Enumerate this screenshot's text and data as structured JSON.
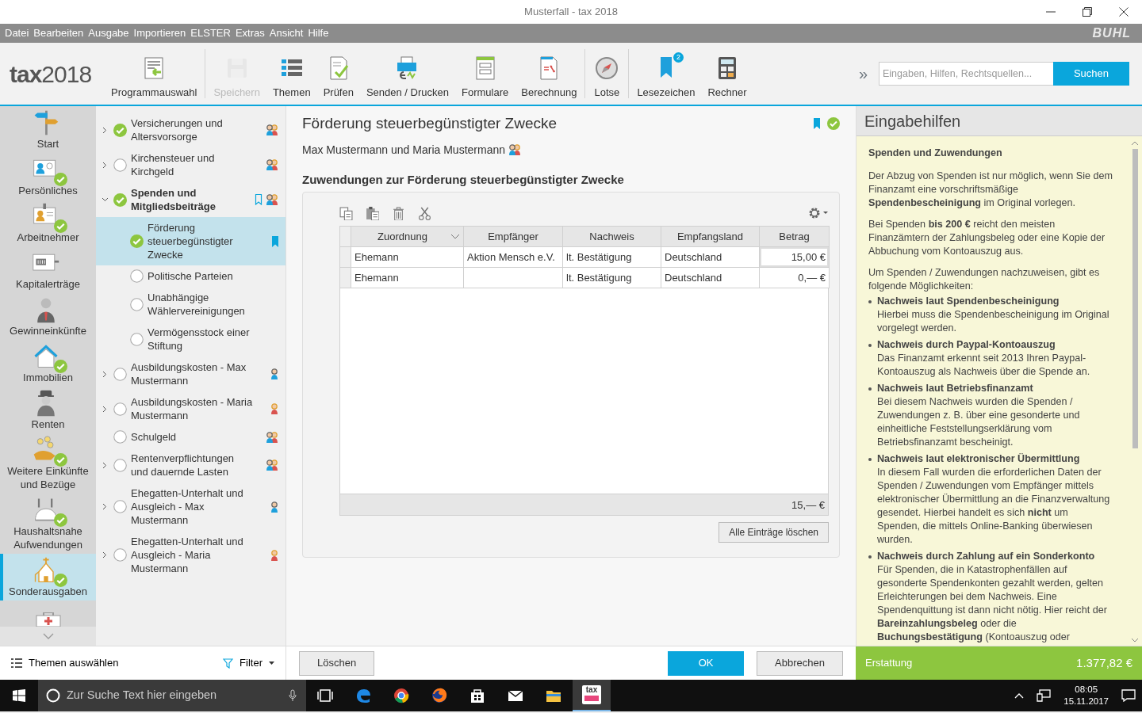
{
  "window": {
    "title": "Musterfall - tax 2018"
  },
  "menu": [
    "Datei",
    "Bearbeiten",
    "Ausgabe",
    "Importieren",
    "ELSTER",
    "Extras",
    "Ansicht",
    "Hilfe"
  ],
  "brand": "BUHL",
  "logo": "**tax**2018",
  "toolbar": [
    {
      "label": "Programmauswahl",
      "disabled": false,
      "divider_after": true
    },
    {
      "label": "Speichern",
      "disabled": true,
      "divider_after": false
    },
    {
      "label": "Themen",
      "disabled": false,
      "divider_after": false
    },
    {
      "label": "Prüfen",
      "disabled": false,
      "divider_after": false
    },
    {
      "label": "Senden / Drucken",
      "disabled": false,
      "divider_after": false
    },
    {
      "label": "Formulare",
      "disabled": false,
      "divider_after": false
    },
    {
      "label": "Berechnung",
      "disabled": false,
      "divider_after": true
    },
    {
      "label": "Lotse",
      "disabled": false,
      "divider_after": true
    },
    {
      "label": "Lesezeichen",
      "disabled": false,
      "divider_after": false,
      "badge": "2"
    },
    {
      "label": "Rechner",
      "disabled": false,
      "divider_after": false
    }
  ],
  "overflow": "»",
  "search": {
    "placeholder": "Eingaben, Hilfen, Rechtsquellen...",
    "button": "Suchen"
  },
  "nav": [
    {
      "label": "Start",
      "done": false,
      "selected": false
    },
    {
      "label": "Persönliches",
      "done": true,
      "selected": false
    },
    {
      "label": "Arbeitnehmer",
      "done": true,
      "selected": false
    },
    {
      "label": "Kapitalerträge",
      "done": false,
      "selected": false
    },
    {
      "label": "Gewinneinkünfte",
      "done": false,
      "selected": false
    },
    {
      "label": "Immobilien",
      "done": true,
      "selected": false
    },
    {
      "label": "Renten",
      "done": false,
      "selected": false
    },
    {
      "label": "Weitere Einkünfte und Bezüge",
      "done": true,
      "selected": false
    },
    {
      "label": "Haushaltsnahe Aufwendungen",
      "done": true,
      "selected": false
    },
    {
      "label": "Sonderausgaben",
      "done": true,
      "selected": true
    }
  ],
  "tree": {
    "items": [
      {
        "label": "Versicherungen und Altersvorsorge",
        "expanded": false,
        "done": true,
        "bookmarked": false,
        "selected": false,
        "husband": true,
        "wife": true
      },
      {
        "label": "Kirchensteuer und Kirchgeld",
        "expanded": false,
        "done": false,
        "bookmarked": false,
        "selected": false,
        "husband": true,
        "wife": true
      },
      {
        "label": "Spenden und Mitgliedsbeiträge",
        "expanded": true,
        "done": true,
        "bookmarked": true,
        "selected": false,
        "husband": true,
        "wife": true,
        "children": [
          {
            "label": "Förderung steuerbegünstigter Zwecke",
            "done": true,
            "bookmarked": true,
            "selected": true
          },
          {
            "label": "Politische Parteien",
            "done": false,
            "bookmarked": false,
            "selected": false
          },
          {
            "label": "Unabhängige Wählervereinigungen",
            "done": false,
            "bookmarked": false,
            "selected": false
          },
          {
            "label": "Vermögensstock einer Stiftung",
            "done": false,
            "bookmarked": false,
            "selected": false
          }
        ]
      },
      {
        "label": "Ausbildungskosten - Max Mustermann",
        "expanded": false,
        "done": false,
        "bookmarked": false,
        "selected": false,
        "husband": true,
        "wife": false
      },
      {
        "label": "Ausbildungskosten - Maria Mustermann",
        "expanded": false,
        "done": false,
        "bookmarked": false,
        "selected": false,
        "husband": false,
        "wife": true
      },
      {
        "label": "Schulgeld",
        "done": false,
        "bookmarked": false,
        "selected": false,
        "husband": true,
        "wife": true
      },
      {
        "label": "Rentenverpflichtungen und dauernde Lasten",
        "expanded": false,
        "done": false,
        "bookmarked": false,
        "selected": false,
        "husband": true,
        "wife": true
      },
      {
        "label": "Ehegatten-Unterhalt und Ausgleich - Max Mustermann",
        "expanded": false,
        "done": false,
        "bookmarked": false,
        "selected": false,
        "husband": true,
        "wife": false
      },
      {
        "label": "Ehegatten-Unterhalt und Ausgleich - Maria Mustermann",
        "expanded": false,
        "done": false,
        "bookmarked": false,
        "selected": false,
        "husband": false,
        "wife": true
      }
    ]
  },
  "page": {
    "title": "Förderung steuerbegünstigter Zwecke",
    "subtitle": "Max Mustermann und Maria Mustermann",
    "bookmarked": true,
    "done": true,
    "section": "Zuwendungen zur Förderung steuerbegünstigter Zwecke",
    "table": {
      "columns": [
        {
          "label": "Zuordnung",
          "dropdown": true
        },
        {
          "label": "Empfänger",
          "dropdown": false
        },
        {
          "label": "Nachweis",
          "dropdown": false
        },
        {
          "label": "Empfangsland",
          "dropdown": false
        },
        {
          "label": "Betrag",
          "dropdown": false
        }
      ],
      "rows": [
        {
          "cells": [
            "Ehemann",
            "Aktion Mensch e.V.",
            "lt. Bestätigung",
            "Deutschland",
            "15,00 €"
          ],
          "focused": true
        },
        {
          "cells": [
            "Ehemann",
            "",
            "lt. Bestätigung",
            "Deutschland",
            "0,— €"
          ],
          "focused": false
        }
      ],
      "total": "15,— €"
    },
    "clear_button": "Alle Einträge löschen"
  },
  "help": {
    "title": "Eingabehilfen",
    "heading": "Spenden und Zuwendungen",
    "paragraphs": [
      "Der Abzug von Spenden ist nur möglich, wenn Sie dem Finanzamt eine vorschriftsmäßige **Spendenbescheinigung** im Original vorlegen.",
      "Bei Spenden **bis 200 €** reicht den meisten Finanzämtern der Zahlungsbeleg oder eine Kopie der Abbuchung vom Kontoauszug aus."
    ],
    "intro": "Um Spenden / Zuwendungen nachzuweisen, gibt es folgende Möglichkeiten:",
    "items": [
      {
        "title": "Nachweis laut Spendenbescheinigung",
        "text": "Hierbei muss die Spendenbescheinigung im Original vorgelegt werden."
      },
      {
        "title": "Nachweis durch Paypal-Kontoauszug",
        "text": "Das Finanzamt erkennt seit 2013 Ihren Paypal-Kontoauszug als Nachweis über die Spende an."
      },
      {
        "title": "Nachweis laut Betriebsfinanzamt",
        "text": "Bei diesem Nachweis wurden die Spenden / Zuwendungen z. B. über eine gesonderte und einheitliche Feststellungserklärung vom Betriebsfinanzamt bescheinigt."
      },
      {
        "title": "Nachweis laut elektronischer Übermittlung",
        "text": "In diesem Fall wurden die erforderlichen Daten der Spenden / Zuwendungen vom Empfänger mittels elektronischer Übermittlung an die Finanzverwaltung gesendet. Hierbei handelt es sich **nicht** um Spenden, die mittels Online-Banking überwiesen wurden."
      },
      {
        "title": "Nachweis durch Zahlung auf ein Sonderkonto",
        "text": "Für Spenden, die in Katastrophenfällen auf gesonderte Spendenkonten gezahlt werden, gelten Erleichterungen bei dem Nachweis. Eine Spendenquittung ist dann nicht nötig. Hier reicht der **Bareinzahlungsbeleg** oder die **Buchungsbestätigung** (Kontoauszug oder"
      }
    ]
  },
  "footer": {
    "topics": "Themen auswählen",
    "filter": "Filter",
    "delete": "Löschen",
    "ok": "OK",
    "cancel": "Abbrechen",
    "refund_label": "Erstattung",
    "refund_value": "1.377,82 €"
  },
  "taskbar": {
    "search_placeholder": "Zur Suche Text hier eingeben",
    "app_badge": "tax",
    "time": "08:05",
    "date": "15.11.2017"
  }
}
